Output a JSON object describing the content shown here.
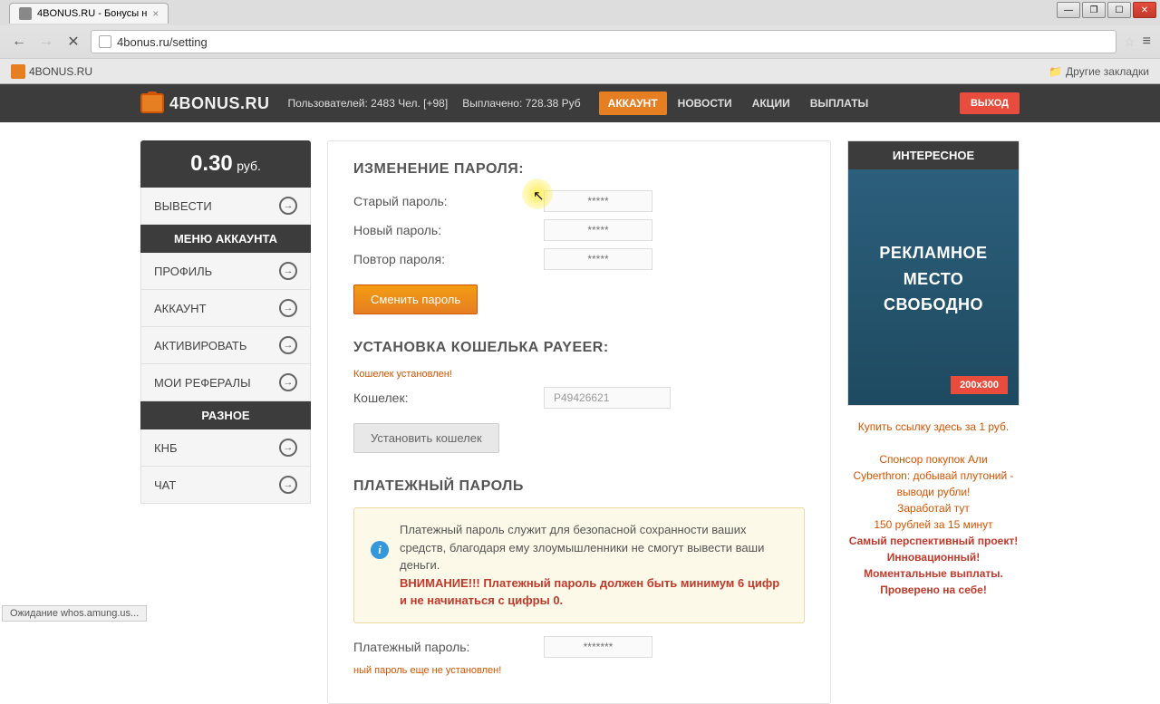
{
  "browser": {
    "tab_title": "4BONUS.RU - Бонусы н",
    "url": "4bonus.ru/setting",
    "bookmark": "4BONUS.RU",
    "other_bookmarks": "Другие закладки",
    "status": "Ожидание whos.amung.us..."
  },
  "header": {
    "logo": "4BONUS.RU",
    "stats_users": "Пользователей: 2483 Чел. [+98]",
    "stats_paid": "Выплачено: 728.38 Руб",
    "nav": [
      "АККАУНТ",
      "НОВОСТИ",
      "АКЦИИ",
      "ВЫПЛАТЫ"
    ],
    "logout": "ВЫХОД"
  },
  "sidebar": {
    "balance_val": "0.30",
    "balance_cur": "руб.",
    "withdraw": "ВЫВЕСТИ",
    "menu_header": "МЕНЮ АККАУНТА",
    "menu_items": [
      "ПРОФИЛЬ",
      "АККАУНТ",
      "АКТИВИРОВАТЬ",
      "МОИ РЕФЕРАЛЫ"
    ],
    "misc_header": "РАЗНОЕ",
    "misc_items": [
      "КНБ",
      "ЧАТ"
    ]
  },
  "main": {
    "password_section": "ИЗМЕНЕНИЕ ПАРОЛЯ:",
    "old_pass": "Старый пароль:",
    "new_pass": "Новый пароль:",
    "repeat_pass": "Повтор пароля:",
    "placeholder_pass": "*****",
    "change_pass_btn": "Сменить пароль",
    "wallet_section": "УСТАНОВКА КОШЕЛЬКА PAYEER:",
    "wallet_note": "Кошелек установлен!",
    "wallet_label": "Кошелек:",
    "wallet_value": "P49426621",
    "wallet_btn": "Установить кошелек",
    "paypass_section": "ПЛАТЕЖНЫЙ ПАРОЛЬ",
    "warning_text": "Платежный пароль служит для безопасной сохранности ваших средств, благодаря ему злоумышленники не смогут вывести ваши деньги.",
    "warning_red": "ВНИМАНИЕ!!! Платежный пароль должен быть минимум 6 цифр и не начинаться с цифры 0.",
    "paypass_label": "Платежный пароль:",
    "paypass_placeholder": "*******",
    "paypass_note": "ный пароль еще не установлен!"
  },
  "right": {
    "ad_header": "ИНТЕРЕСНОЕ",
    "ad_line1": "РЕКЛАМНОЕ",
    "ad_line2": "МЕСТО",
    "ad_line3": "СВОБОДНО",
    "ad_size": "200x300",
    "links_buy": "Купить ссылку здесь за 1 руб.",
    "links_1": "Спонсор покупок Али",
    "links_2": "Cyberthron: добывай плутоний - выводи рубли!",
    "links_3": "Заработай тут",
    "links_4": "150 рублей за 15 минут",
    "links_red1": "Самый перспективный проект!",
    "links_red2": "Инновационный! Моментальные выплаты. Проверено на себе!"
  }
}
